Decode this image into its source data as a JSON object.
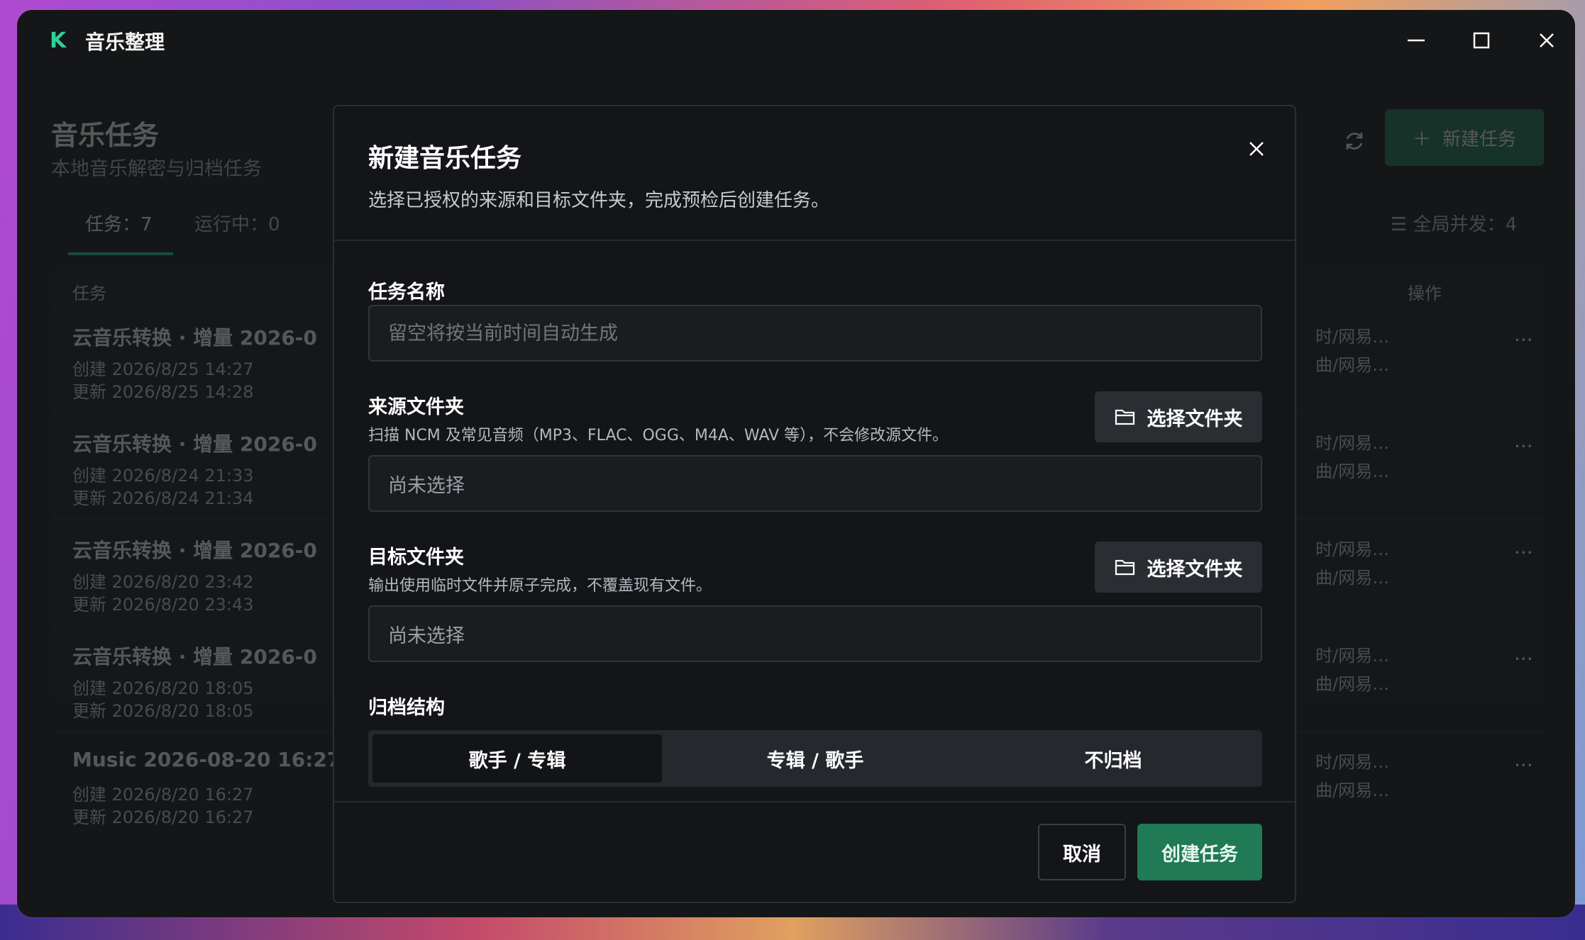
{
  "window": {
    "logo": "K",
    "title": "音乐整理"
  },
  "page": {
    "title": "音乐任务",
    "subtitle": "本地音乐解密与归档任务",
    "new_task_label": "新建任务",
    "tab_tasks": "任务：7",
    "tab_running": "运行中：0",
    "concurrency": "全局并发：4",
    "table": {
      "col_task": "任务",
      "col_ops": "操作",
      "rows": [
        {
          "title": "云音乐转换 · 增量 2026-0",
          "created": "创建 2026/8/25 14:27",
          "updated": "更新 2026/8/25 14:28",
          "path1": "时/网易…",
          "path2": "曲/网易…"
        },
        {
          "title": "云音乐转换 · 增量 2026-0",
          "created": "创建 2026/8/24 21:33",
          "updated": "更新 2026/8/24 21:34",
          "path1": "时/网易…",
          "path2": "曲/网易…"
        },
        {
          "title": "云音乐转换 · 增量 2026-0",
          "created": "创建 2026/8/20 23:42",
          "updated": "更新 2026/8/20 23:43",
          "path1": "时/网易…",
          "path2": "曲/网易…"
        },
        {
          "title": "云音乐转换 · 增量 2026-0",
          "created": "创建 2026/8/20 18:05",
          "updated": "更新 2026/8/20 18:05",
          "path1": "时/网易…",
          "path2": "曲/网易…"
        },
        {
          "title": "Music 2026-08-20 16:27",
          "created": "创建 2026/8/20 16:27",
          "updated": "更新 2026/8/20 16:27",
          "path1": "时/网易…",
          "path2": "曲/网易…"
        }
      ],
      "more": "···"
    }
  },
  "modal": {
    "title": "新建音乐任务",
    "description": "选择已授权的来源和目标文件夹，完成预检后创建任务。",
    "name_label": "任务名称",
    "name_placeholder": "留空将按当前时间自动生成",
    "source_label": "来源文件夹",
    "source_hint": "扫描 NCM 及常见音频（MP3、FLAC、OGG、M4A、WAV 等），不会修改源文件。",
    "source_value": "尚未选择",
    "choose_folder": "选择文件夹",
    "target_label": "目标文件夹",
    "target_hint": "输出使用临时文件并原子完成，不覆盖现有文件。",
    "target_value": "尚未选择",
    "archive_label": "归档结构",
    "archive_options": [
      "歌手 / 专辑",
      "专辑 / 歌手",
      "不归档"
    ],
    "archive_selected": "歌手 / 专辑",
    "cancel": "取消",
    "create": "创建任务"
  },
  "colors": {
    "accent": "#2fcf9a",
    "primary_button": "#1f7a55",
    "modal_bg": "#131518"
  }
}
